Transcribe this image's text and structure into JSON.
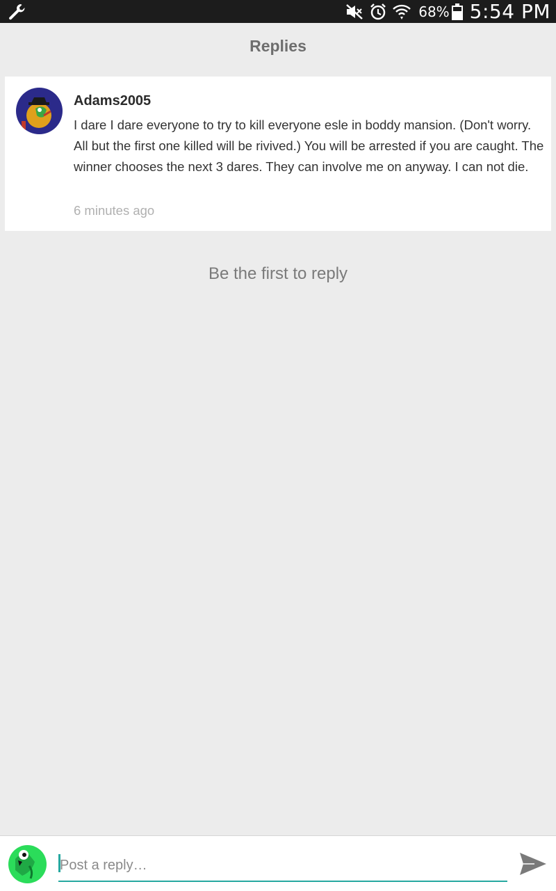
{
  "status_bar": {
    "battery": "68%",
    "time": "5:54 PM",
    "icons": [
      "wrench-icon",
      "mute-icon",
      "alarm-icon",
      "wifi-icon",
      "battery-icon"
    ]
  },
  "header": {
    "title": "Replies"
  },
  "post": {
    "author": "Adams2005",
    "body": "I dare I dare everyone to try to kill everyone esle in boddy mansion. (Don't worry. All but the first one killed will be rivived.) You will be arrested if you are caught. The winner chooses the next 3 dares. They can involve me on anyway. I can not die.",
    "time": "6 minutes ago"
  },
  "replies": {
    "empty_text": "Be the first to reply"
  },
  "composer": {
    "placeholder": "Post a reply…"
  },
  "colors": {
    "accent": "#26a8a0",
    "background": "#ececec",
    "status_bar": "#1c1c1c"
  }
}
